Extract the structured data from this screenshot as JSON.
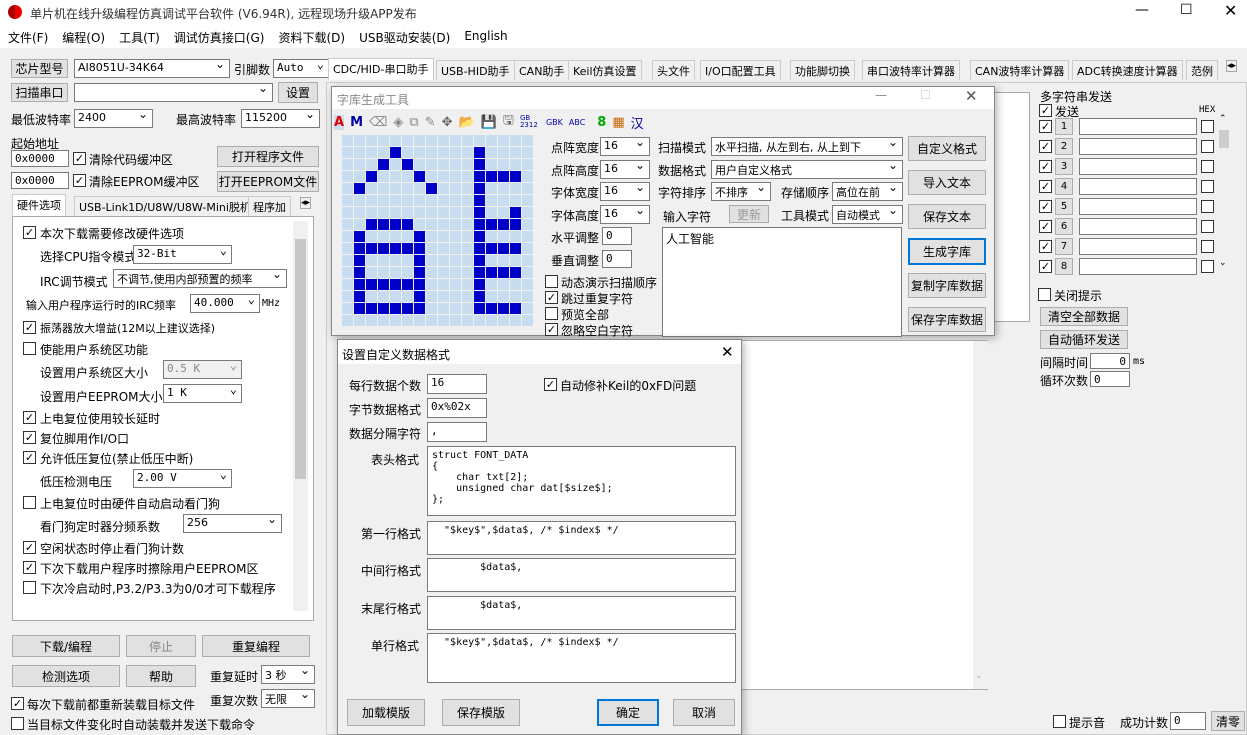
{
  "title": "单片机在线升级编程仿真调试平台软件 (V6.94R), 远程现场升级APP发布",
  "menu": [
    "文件(F)",
    "编程(O)",
    "工具(T)",
    "调试仿真接口(G)",
    "资料下载(D)",
    "USB驱动安装(D)",
    "English"
  ],
  "left": {
    "chip_label": "芯片型号",
    "chip_value": "AI8051U-34K64",
    "pin_label": "引脚数",
    "pin_value": "Auto",
    "scan_label": "扫描串口",
    "port_value": "",
    "settings_label": "设置",
    "min_baud_label": "最低波特率",
    "min_baud": "2400",
    "max_baud_label": "最高波特率",
    "max_baud": "115200",
    "start_addr_label": "起始地址",
    "addr1": "0x0000",
    "clear_code": "清除代码缓冲区",
    "open_prog": "打开程序文件",
    "addr2": "0x0000",
    "clear_eeprom": "清除EEPROM缓冲区",
    "open_eeprom": "打开EEPROM文件",
    "tabs": [
      "硬件选项",
      "USB-Link1D/U8W/U8W-Mini脱机",
      "程序加"
    ],
    "opt_modify": "本次下载需要修改硬件选项",
    "cpu_label": "选择CPU指令模式",
    "cpu_value": "32-Bit",
    "irc_label": "IRC调节模式",
    "irc_value": "不调节,使用内部预置的频率",
    "freq_label": "输入用户程序运行时的IRC频率",
    "freq_value": "40.000",
    "freq_unit": "MHz",
    "osc_gain": "振荡器放大增益(12M以上建议选择)",
    "use_sys": "使能用户系统区功能",
    "sys_size_label": "设置用户系统区大小",
    "sys_size": "0.5 K",
    "eeprom_size_label": "设置用户EEPROM大小",
    "eeprom_size": "1   K",
    "long_delay": "上电复位使用较长延时",
    "reset_io": "复位脚用作I/O口",
    "lvr": "允许低压复位(禁止低压中断)",
    "lvd_label": "低压检测电压",
    "lvd_value": "2.00 V",
    "wdt_auto": "上电复位时由硬件自动启动看门狗",
    "wdt_div_label": "看门狗定时器分频系数",
    "wdt_div": "256",
    "idle_wdt": "空闲状态时停止看门狗计数",
    "erase_eeprom": "下次下载用户程序时擦除用户EEPROM区",
    "p32": "下次冷启动时,P3.2/P3.3为0/0才可下载程序",
    "download": "下载/编程",
    "stop": "停止",
    "reprog": "重复编程",
    "detect": "检测选项",
    "help": "帮助",
    "repeat_delay_label": "重复延时",
    "repeat_delay": "3 秒",
    "repeat_count_label": "重复次数",
    "repeat_count": "无限",
    "reload_each": "每次下载前都重新装载目标文件",
    "auto_send": "当目标文件变化时自动装载并发送下载命令"
  },
  "main_tabs": [
    "CDC/HID-串口助手",
    "USB-HID助手",
    "CAN助手",
    "Keil仿真设置",
    "头文件",
    "I/O口配置工具",
    "功能脚切换",
    "串口波特率计算器",
    "CAN波特率计算器",
    "ADC转换速度计算器",
    "范例"
  ],
  "font_tool": {
    "title": "字库生成工具",
    "toolbar_text": [
      "GB 2312",
      "GBK",
      "ABC",
      "8",
      "汉"
    ],
    "dot_w_label": "点阵宽度",
    "dot_w": "16",
    "dot_h_label": "点阵高度",
    "dot_h": "16",
    "font_w_label": "字体宽度",
    "font_w": "16",
    "font_h_label": "字体高度",
    "font_h": "16",
    "h_adj_label": "水平调整",
    "h_adj": "0",
    "v_adj_label": "垂直调整",
    "v_adj": "0",
    "scan_mode_label": "扫描模式",
    "scan_mode": "水平扫描, 从左到右, 从上到下",
    "data_fmt_label": "数据格式",
    "data_fmt": "用户自定义格式",
    "char_sort_label": "字符排序",
    "char_sort": "不排序",
    "store_label": "存储顺序",
    "store": "高位在前",
    "input_label": "输入字符",
    "update": "更新",
    "tool_mode_label": "工具模式",
    "tool_mode": "自动模式",
    "input_text": "人工智能",
    "demo_scan": "动态演示扫描顺序",
    "skip_dup": "跳过重复字符",
    "preview_all": "预览全部",
    "ignore_blank": "忽略空白字符",
    "custom_fmt": "自定义格式",
    "import": "导入文本",
    "save_text": "保存文本",
    "gen": "生成字库",
    "copy": "复制字库数据",
    "save_data": "保存字库数据"
  },
  "custom_dlg": {
    "title": "设置自定义数据格式",
    "per_line_label": "每行数据个数",
    "per_line": "16",
    "byte_fmt_label": "字节数据格式",
    "byte_fmt": "0x%02x",
    "sep_label": "数据分隔字符",
    "sep": ",",
    "keil_fix": "自动修补Keil的0xFD问题",
    "header_label": "表头格式",
    "header": "struct FONT_DATA\n{\n    char txt[2];\n    unsigned char dat[$size$];\n};",
    "first_label": "第一行格式",
    "first": "  \"$key$\",$data$, /* $index$ */",
    "mid_label": "中间行格式",
    "mid": "        $data$,",
    "last_label": "末尾行格式",
    "last": "        $data$,",
    "single_label": "单行格式",
    "single": "  \"$key$\",$data$, /* $index$ */",
    "load": "加载模版",
    "save": "保存模版",
    "ok": "确定",
    "cancel": "取消"
  },
  "right": {
    "group": "多字符串发送",
    "send": "发送",
    "hex": "HEX",
    "rows": [
      "1",
      "2",
      "3",
      "4",
      "5",
      "6",
      "7",
      "8"
    ],
    "close_tip": "关闭提示",
    "clear_all": "清空全部数据",
    "auto_loop": "自动循环发送",
    "interval_label": "间隔时间",
    "interval": "0",
    "interval_unit": "ms",
    "loop_label": "循环次数",
    "loop": "0",
    "tip_sound": "提示音",
    "success_label": "成功计数",
    "success": "0",
    "clear": "清零"
  },
  "colors": {
    "pixel_on": "#0000c8",
    "pixel_off": "#c8dcf0",
    "accent": "#0078d7"
  }
}
